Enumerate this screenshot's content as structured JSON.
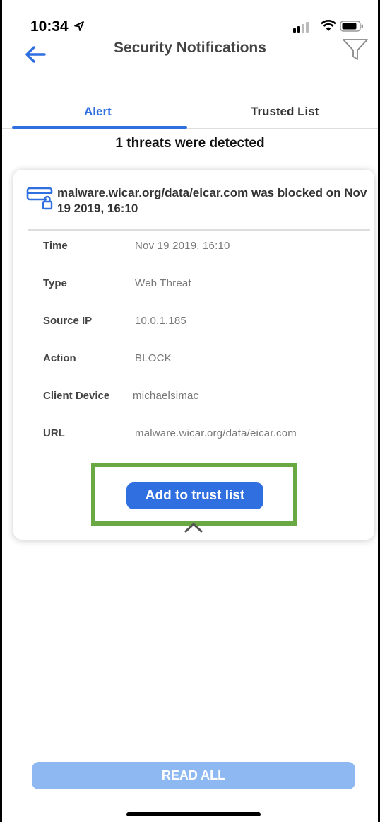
{
  "status_bar": {
    "time": "10:34"
  },
  "header": {
    "title": "Security Notifications"
  },
  "tabs": [
    {
      "label": "Alert",
      "active": true
    },
    {
      "label": "Trusted List",
      "active": false
    }
  ],
  "summary": "1 threats were detected",
  "threat": {
    "title": "malware.wicar.org/data/eicar.com was blocked on Nov 19 2019, 16:10",
    "details": [
      {
        "label": "Time",
        "value": "Nov 19 2019, 16:10"
      },
      {
        "label": "Type",
        "value": "Web Threat"
      },
      {
        "label": "Source IP",
        "value": "10.0.1.185"
      },
      {
        "label": "Action",
        "value": "BLOCK"
      },
      {
        "label": "Client Device",
        "value": "michaelsimac"
      },
      {
        "label": "URL",
        "value": "malware.wicar.org/data/eicar.com"
      }
    ],
    "trust_button": "Add to trust list"
  },
  "footer": {
    "read_all": "READ ALL"
  },
  "colors": {
    "accent": "#2f6fe0",
    "accent_light": "#8db8f2",
    "highlight": "#6aa843"
  }
}
